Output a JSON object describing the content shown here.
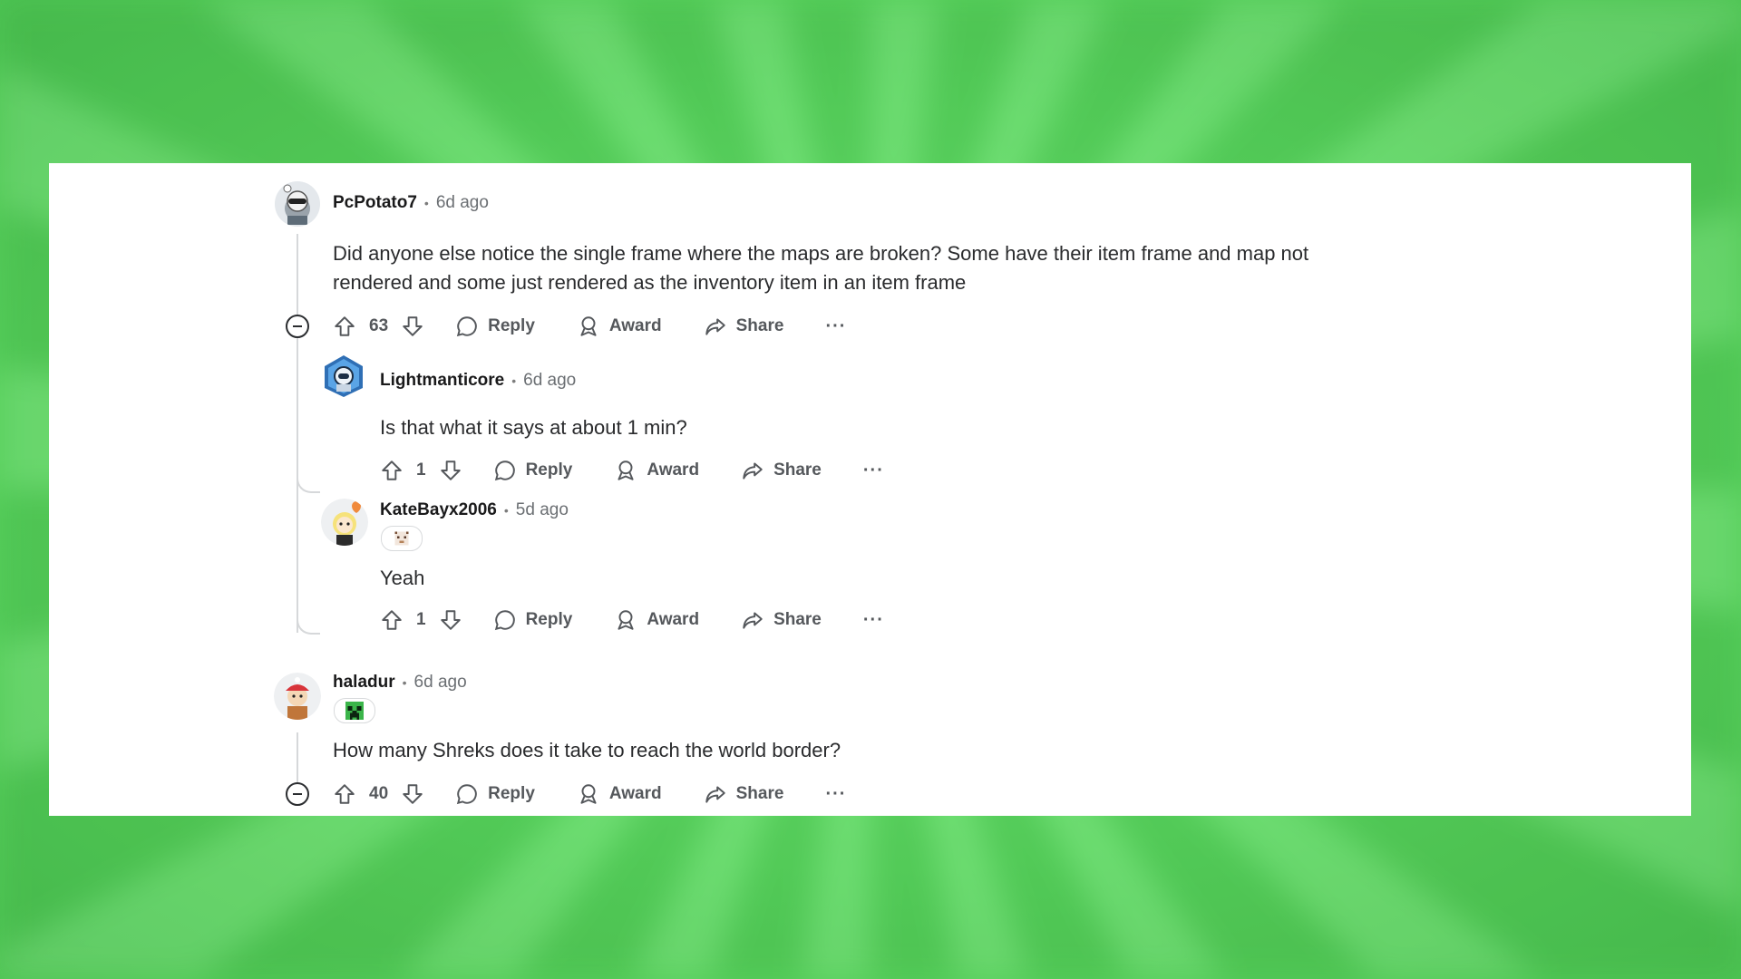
{
  "comments": [
    {
      "username": "PcPotato7",
      "time": "6d ago",
      "body": "Did anyone else notice the single frame where the maps are broken? Some have their item frame and map not rendered and some just rendered as the inventory item in an item frame",
      "votes": "63"
    },
    {
      "username": "Lightmanticore",
      "time": "6d ago",
      "body": "Is that what it says at about 1 min?",
      "votes": "1"
    },
    {
      "username": "KateBayx2006",
      "time": "5d ago",
      "body": "Yeah",
      "votes": "1"
    },
    {
      "username": "haladur",
      "time": "6d ago",
      "body": "How many Shreks does it take to reach the world border?",
      "votes": "40"
    }
  ],
  "actions": {
    "reply": "Reply",
    "award": "Award",
    "share": "Share",
    "more": "···"
  },
  "separator": "•",
  "colors": {
    "background": "#6fe872",
    "card": "#ffffff",
    "text": "#2a2b2d",
    "muted": "#55585c"
  }
}
